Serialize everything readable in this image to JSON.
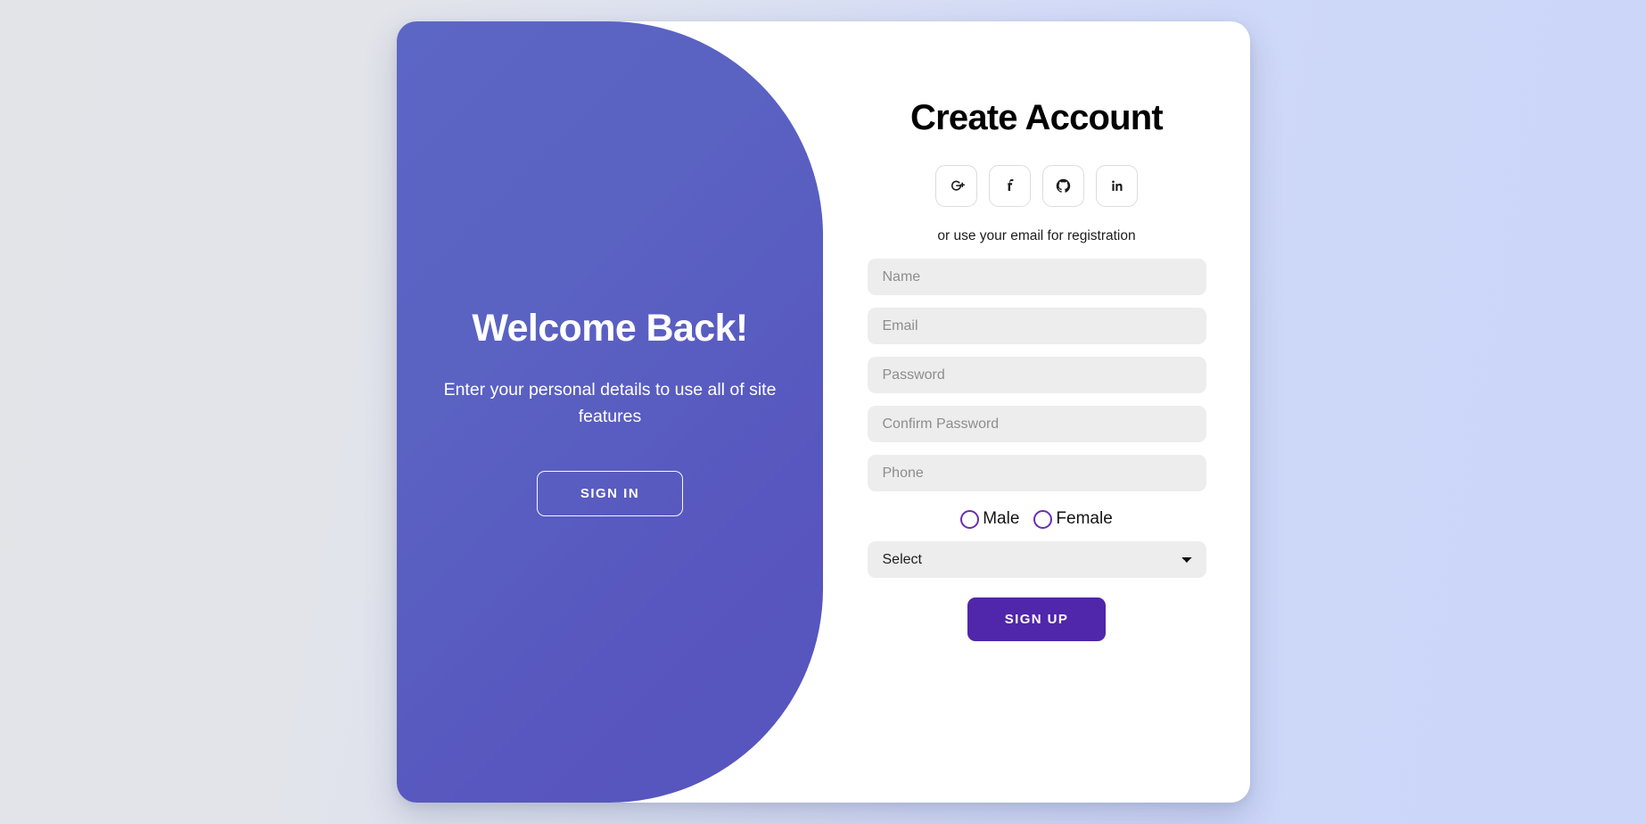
{
  "background": {
    "left_color": "#e3e4e8",
    "right_color": "#ccd6f8"
  },
  "card": {
    "accent_color": "#5026ab",
    "panel_gradient_from": "#5c66c4",
    "panel_gradient_to": "#5654bd"
  },
  "welcome_panel": {
    "title": "Welcome Back!",
    "subtitle": "Enter your personal details to use all of site features",
    "sign_in_label": "SIGN IN"
  },
  "signup_panel": {
    "title": "Create Account",
    "social_hint": "or use your email for registration",
    "social_buttons": [
      {
        "name": "google-plus",
        "label": "G+"
      },
      {
        "name": "facebook",
        "label": "f"
      },
      {
        "name": "github",
        "label": "GitHub"
      },
      {
        "name": "linkedin",
        "label": "in"
      }
    ],
    "fields": [
      {
        "name": "name",
        "placeholder": "Name",
        "value": ""
      },
      {
        "name": "email",
        "placeholder": "Email",
        "value": ""
      },
      {
        "name": "password",
        "placeholder": "Password",
        "value": ""
      },
      {
        "name": "confirm-password",
        "placeholder": "Confirm Password",
        "value": ""
      },
      {
        "name": "phone",
        "placeholder": "Phone",
        "value": ""
      }
    ],
    "gender": {
      "options": [
        {
          "label": "Male",
          "checked": false
        },
        {
          "label": "Female",
          "checked": false
        }
      ],
      "radio_border_color": "#6a2cb0"
    },
    "select": {
      "selected": "Select",
      "options": [
        "Select"
      ]
    },
    "sign_up_label": "SIGN UP"
  }
}
